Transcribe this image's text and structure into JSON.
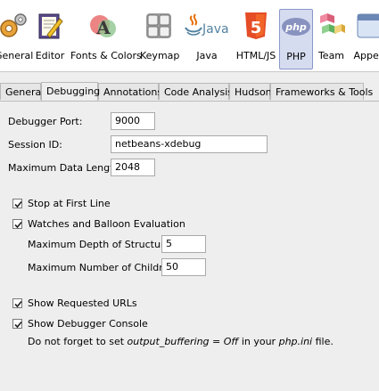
{
  "toolbar": {
    "categories": [
      {
        "label": "General",
        "icon": "gears-icon"
      },
      {
        "label": "Editor",
        "icon": "editor-pencil-icon"
      },
      {
        "label": "Fonts & Colors",
        "icon": "fonts-colors-icon"
      },
      {
        "label": "Keymap",
        "icon": "keyboard-icon"
      },
      {
        "label": "Java",
        "icon": "java-logo-icon",
        "logo_text": "Java"
      },
      {
        "label": "HTML/JS",
        "icon": "html5-icon",
        "logo_text": "5"
      },
      {
        "label": "PHP",
        "icon": "php-logo-icon",
        "logo_text": "php",
        "selected": true
      },
      {
        "label": "Team",
        "icon": "team-cubes-icon"
      },
      {
        "label": "Appea",
        "icon": "appearance-icon"
      }
    ]
  },
  "tabs": [
    {
      "label": "General"
    },
    {
      "label": "Debugging",
      "active": true
    },
    {
      "label": "Annotations"
    },
    {
      "label": "Code Analysis"
    },
    {
      "label": "Hudson"
    },
    {
      "label": "Frameworks & Tools"
    }
  ],
  "form": {
    "debugger_port_label": "Debugger Port:",
    "debugger_port_value": "9000",
    "session_id_label": "Session ID:",
    "session_id_value": "netbeans-xdebug",
    "max_data_length_label": "Maximum Data Length:",
    "max_data_length_value": "2048",
    "stop_at_first_line_label": "Stop at First Line",
    "stop_at_first_line_checked": true,
    "watches_label": "Watches and Balloon Evaluation",
    "watches_checked": true,
    "max_depth_label": "Maximum Depth of Structures:",
    "max_depth_value": "5",
    "max_children_label": "Maximum Number of Children:",
    "max_children_value": "50",
    "show_urls_label": "Show Requested URLs",
    "show_urls_checked": true,
    "show_console_label": "Show Debugger Console",
    "show_console_checked": true,
    "note_prefix": "Do not forget to set ",
    "note_setting": "output_buffering = Off",
    "note_middle": " in your ",
    "note_file": "php.ini",
    "note_suffix": " file."
  },
  "colors": {
    "selected_category_bg": "#d6dcf0",
    "php_logo_bg": "#8892bf",
    "html5_orange": "#e44d26",
    "java_blue": "#5382a1",
    "java_red": "#e76f00"
  }
}
